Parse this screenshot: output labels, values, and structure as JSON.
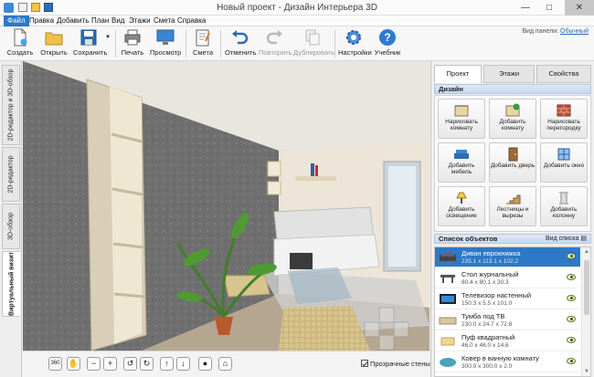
{
  "window": {
    "title": "Новый проект - Дизайн Интерьера 3D"
  },
  "menu": [
    "Файл",
    "Правка",
    "Добавить",
    "План",
    "Вид",
    "Этажи",
    "Смета",
    "Справка"
  ],
  "toolbar": {
    "buttons": [
      {
        "id": "create",
        "label": "Создать"
      },
      {
        "id": "open",
        "label": "Открыть"
      },
      {
        "id": "save",
        "label": "Сохранить"
      },
      {
        "id": "print",
        "label": "Печать"
      },
      {
        "id": "preview",
        "label": "Просмотр"
      },
      {
        "id": "estimate",
        "label": "Смета"
      },
      {
        "id": "undo",
        "label": "Отменить"
      },
      {
        "id": "redo",
        "label": "Повторить"
      },
      {
        "id": "duplicate",
        "label": "Дублировать"
      },
      {
        "id": "settings",
        "label": "Настройки"
      },
      {
        "id": "tutorial",
        "label": "Учебник"
      }
    ],
    "panel_view_label": "Вид панели:",
    "panel_view_value": "Обычный"
  },
  "view_tabs": [
    "2D-редактор и 3D-обзор",
    "2D-редактор",
    "3D-обзор",
    "Виртуальный визит"
  ],
  "right_panel": {
    "tabs": [
      "Проект",
      "Этажи",
      "Свойства"
    ],
    "design_section": "Дизайн",
    "design_buttons": [
      "Нарисовать комнату",
      "Добавить комнату",
      "Нарисовать перегородку",
      "Добавить мебель",
      "Добавить дверь",
      "Добавить окно",
      "Добавить освещение",
      "Лестницы и вырезы",
      "Добавить колонну"
    ],
    "objects_section": "Список объектов",
    "list_view_link": "Вид списка",
    "objects": [
      {
        "name": "Диван еврокнижка",
        "size": "235.1 x 113.1 x 102.2"
      },
      {
        "name": "Стол журнальный",
        "size": "80.4 x 80.1 x 30.3"
      },
      {
        "name": "Телевизор настенный",
        "size": "150.3 x 5.5 x 101.0"
      },
      {
        "name": "Тумба под ТВ",
        "size": "230.0 x 24.7 x 72.8"
      },
      {
        "name": "Пуф квадратный",
        "size": "46.0 x 46.0 x 14.6"
      },
      {
        "name": "Ковер в ванную комнату",
        "size": "300.0 x 300.0 x 2.0"
      }
    ]
  },
  "viewport_controls": [
    "360",
    "hand",
    "zoom-out",
    "zoom-in",
    "orbit-left",
    "orbit-right",
    "tilt-up",
    "tilt-down",
    "lightbulb",
    "home"
  ],
  "transparent_walls_label": "Прозрачные стены",
  "colors": {
    "accent": "#2d79c6",
    "selection": "#2d79c6"
  }
}
